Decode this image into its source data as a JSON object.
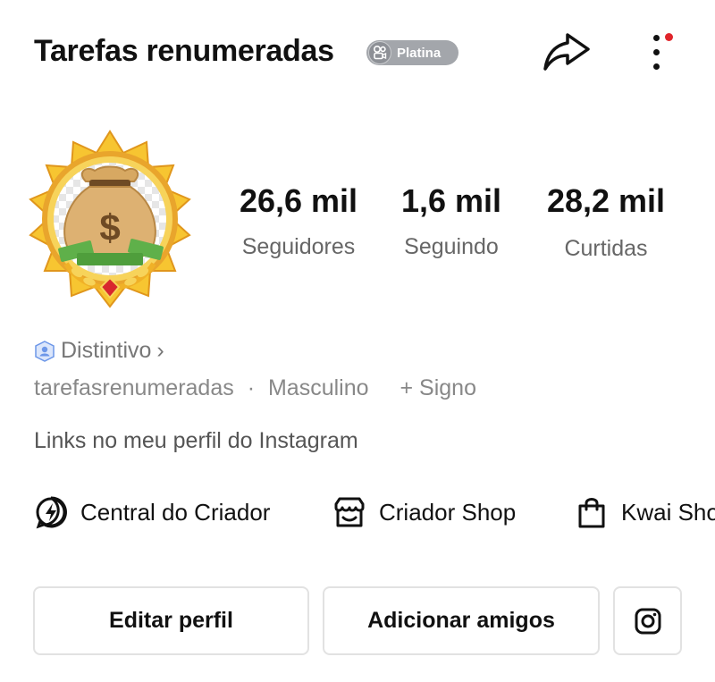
{
  "header": {
    "title": "Tarefas renumeradas",
    "badge_label": "Platina",
    "badge_icon": "kwai-logo-icon",
    "share_icon": "share-arrow-icon",
    "more_icon": "more-vertical-icon",
    "notification_color": "#e0252b"
  },
  "avatar": {
    "icon": "money-bag-icon",
    "frame_color": "#f5b323"
  },
  "stats": [
    {
      "value": "26,6 mil",
      "label": "Seguidores"
    },
    {
      "value": "1,6 mil",
      "label": "Seguindo"
    },
    {
      "value": "28,2 mil",
      "label": "Curtidas"
    }
  ],
  "profile": {
    "distintivo_label": "Distintivo",
    "chevron": "›",
    "username": "tarefasrenumeradas",
    "separator": "·",
    "gender": "Masculino",
    "add_sign": "+ Signo",
    "bio": "Links no meu perfil do Instagram"
  },
  "shortcuts": [
    {
      "label": "Central do Criador",
      "icon": "lightning-circle-icon"
    },
    {
      "label": "Criador Shop",
      "icon": "storefront-icon"
    },
    {
      "label": "Kwai Sho",
      "icon": "shopping-bag-icon"
    }
  ],
  "actions": {
    "edit_label": "Editar perfil",
    "add_friends_label": "Adicionar amigos",
    "instagram_icon": "instagram-icon"
  }
}
